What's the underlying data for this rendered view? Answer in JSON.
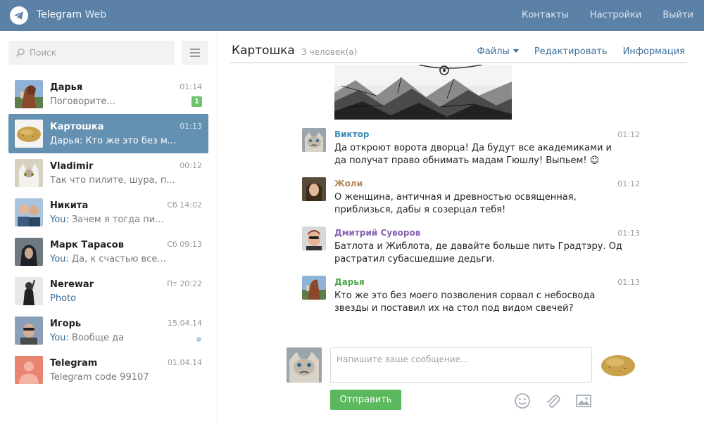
{
  "header": {
    "brand_main": "Telegram",
    "brand_sub": " Web",
    "nav": [
      "Контакты",
      "Настройки",
      "Выйти"
    ]
  },
  "search": {
    "placeholder": "Поиск"
  },
  "dialogs": [
    {
      "name": "Дарья",
      "time": "01:14",
      "message": "Поговорите...",
      "badge": "1"
    },
    {
      "name": "Картошка",
      "time": "01:13",
      "message": "Дарья: Кто же это без м..."
    },
    {
      "name": "Vladimir",
      "time": "00:12",
      "message": "Так что пилите, шура, п..."
    },
    {
      "name": "Никита",
      "time": "Сб 14:02",
      "you": "You:",
      "message": " Зачем я тогда пи..."
    },
    {
      "name": "Марк Тарасов",
      "time": "Сб 09:13",
      "you": "You:",
      "message": " Да, к счастью все..."
    },
    {
      "name": "Nerewar",
      "time": "Пт 20:22",
      "message": "Photo"
    },
    {
      "name": "Игорь",
      "time": "15.04.14",
      "you": "You:",
      "message": " Вообще да"
    },
    {
      "name": "Telegram",
      "time": "01.04.14",
      "message": "Telegram code 99107"
    }
  ],
  "chat": {
    "title": "Картошка",
    "members": "3 человек(а)",
    "files": "Файлы",
    "edit": "Редактировать",
    "info": "Информация"
  },
  "messages": [
    {
      "author": "Виктор",
      "time": "01:12",
      "text": "Да откроют ворота дворца! Да будут все академиками и да получат право обнимать мадам Гюшлу! Выпьем! ☺",
      "color": "#3a8bb8"
    },
    {
      "author": "Жоли",
      "time": "01:12",
      "text": "О женщина, античная и древностью освященная, приблизься, дабы я созерцал тебя!",
      "color": "#b48a5a"
    },
    {
      "author": "Дмитрий Суворов",
      "time": "01:13",
      "text": "Батлота и Жиблота, де давайте больше пить Градтэру. Од растратил субасшедшие дедьги.",
      "color": "#8862b4"
    },
    {
      "author": "Дарья",
      "time": "01:13",
      "text": "Кто же это без моего позволения сорвал с небосвода звезды и поставил их на стол под видом свечей?",
      "color": "#4ea64e"
    }
  ],
  "composer": {
    "placeholder": "Напишите ваше сообщение...",
    "send": "Отправить"
  },
  "icons": [
    "telegram-logo-icon",
    "search-icon",
    "menu-icon",
    "smile-icon",
    "paperclip-icon",
    "image-icon"
  ],
  "colors": {
    "header": "#5b81a7",
    "active_dialog": "#6490b1",
    "send_button": "#5cb85c",
    "link": "#3a6d99"
  }
}
